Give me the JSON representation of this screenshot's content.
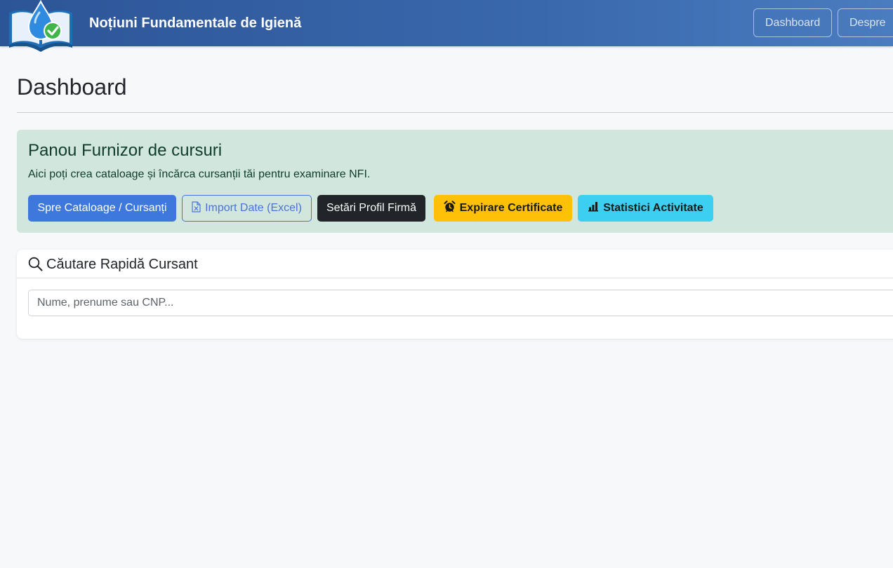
{
  "navbar": {
    "brand": "Noțiuni Fundamentale de Igienă",
    "logo_icon": "book-water-drop-check-icon",
    "links": [
      {
        "label": "Dashboard"
      },
      {
        "label": "Despre"
      }
    ]
  },
  "page": {
    "title": "Dashboard"
  },
  "panel": {
    "title": "Panou Furnizor de cursuri",
    "text": "Aici poți crea cataloage și încărca cursanții tăi pentru examinare NFI.",
    "buttons": {
      "catalogs": "Spre Cataloage / Cursanți",
      "import": "Import Date (Excel)",
      "settings": "Setări Profil Firmă",
      "expiry": "Expirare Certificate",
      "stats": "Statistici Activitate"
    }
  },
  "search": {
    "title": "Căutare Rapidă Cursant",
    "placeholder": "Nume, prenume sau CNP..."
  },
  "colors": {
    "navbar": "#3a68ad",
    "primary": "#3f78dc",
    "warning": "#ffc107",
    "info": "#3dcff2",
    "dark": "#212529",
    "panel_bg": "#d1e7dd"
  }
}
